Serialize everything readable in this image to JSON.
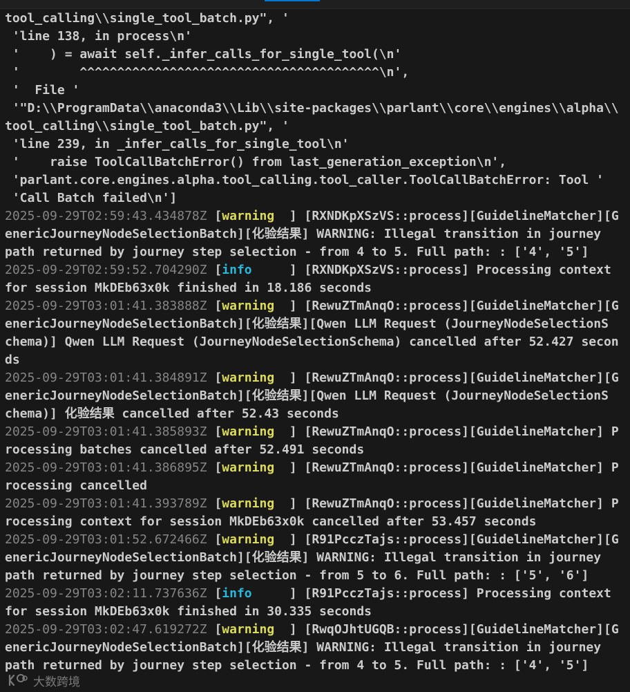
{
  "terminal": {
    "lines": [
      [
        {
          "t": "tool_calling\\\\single_tool_batch.py\", '"
        }
      ],
      [
        {
          "t": " 'line 138, in process\\n'"
        }
      ],
      [
        {
          "t": " '    ) = await self._infer_calls_for_single_tool(\\n'"
        }
      ],
      [
        {
          "t": " '        ^^^^^^^^^^^^^^^^^^^^^^^^^^^^^^^^^^^^^^^^\\n',"
        }
      ],
      [
        {
          "t": " '  File '"
        }
      ],
      [
        {
          "t": " '\"D:\\\\ProgramData\\\\anaconda3\\\\Lib\\\\site-packages\\\\parlant\\\\core\\\\engines\\\\alpha\\\\"
        }
      ],
      [
        {
          "t": "tool_calling\\\\single_tool_batch.py\", '"
        }
      ],
      [
        {
          "t": " 'line 239, in _infer_calls_for_single_tool\\n'"
        }
      ],
      [
        {
          "t": " '    raise ToolCallBatchError() from last_generation_exception\\n',"
        }
      ],
      [
        {
          "t": " 'parlant.core.engines.alpha.tool_calling.tool_caller.ToolCallBatchError: Tool '"
        }
      ],
      [
        {
          "t": " 'Call Batch failed\\n']"
        }
      ],
      [
        {
          "c": "ts",
          "t": "2025-09-29T02:59:43.434878Z"
        },
        {
          "t": " ["
        },
        {
          "c": "lvl-warning",
          "t": "warning"
        },
        {
          "t": "  ] [RXNDKpXSzVS::process][GuidelineMatcher][G"
        }
      ],
      [
        {
          "t": "enericJourneyNodeSelectionBatch]["
        },
        {
          "c": "cjk",
          "t": "化验结果"
        },
        {
          "t": "] WARNING: Illegal transition in journey"
        }
      ],
      [
        {
          "t": "path returned by journey step selection - from 4 to 5. Full path: : ['4', '5']"
        }
      ],
      [
        {
          "c": "ts",
          "t": "2025-09-29T02:59:52.704290Z"
        },
        {
          "t": " ["
        },
        {
          "c": "lvl-info",
          "t": "info"
        },
        {
          "t": "     ] [RXNDKpXSzVS::process] Processing context"
        }
      ],
      [
        {
          "t": "for session MkDEb63x0k finished in 18.186 seconds"
        }
      ],
      [
        {
          "c": "ts",
          "t": "2025-09-29T03:01:41.383888Z"
        },
        {
          "t": " ["
        },
        {
          "c": "lvl-warning",
          "t": "warning"
        },
        {
          "t": "  ] [RewuZTmAnqO::process][GuidelineMatcher][G"
        }
      ],
      [
        {
          "t": "enericJourneyNodeSelectionBatch]["
        },
        {
          "c": "cjk",
          "t": "化验结果"
        },
        {
          "t": "][Qwen LLM Request (JourneyNodeSelectionS"
        }
      ],
      [
        {
          "t": "chema)] Qwen LLM Request (JourneyNodeSelectionSchema) cancelled after 52.427 secon"
        }
      ],
      [
        {
          "t": "ds"
        }
      ],
      [
        {
          "c": "ts",
          "t": "2025-09-29T03:01:41.384891Z"
        },
        {
          "t": " ["
        },
        {
          "c": "lvl-warning",
          "t": "warning"
        },
        {
          "t": "  ] [RewuZTmAnqO::process][GuidelineMatcher][G"
        }
      ],
      [
        {
          "t": "enericJourneyNodeSelectionBatch]["
        },
        {
          "c": "cjk",
          "t": "化验结果"
        },
        {
          "t": "][Qwen LLM Request (JourneyNodeSelectionS"
        }
      ],
      [
        {
          "t": "chema)] "
        },
        {
          "c": "cjk",
          "t": "化验结果"
        },
        {
          "t": " cancelled after 52.43 seconds"
        }
      ],
      [
        {
          "c": "ts",
          "t": "2025-09-29T03:01:41.385893Z"
        },
        {
          "t": " ["
        },
        {
          "c": "lvl-warning",
          "t": "warning"
        },
        {
          "t": "  ] [RewuZTmAnqO::process][GuidelineMatcher] P"
        }
      ],
      [
        {
          "t": "rocessing batches cancelled after 52.491 seconds"
        }
      ],
      [
        {
          "c": "ts",
          "t": "2025-09-29T03:01:41.386895Z"
        },
        {
          "t": " ["
        },
        {
          "c": "lvl-warning",
          "t": "warning"
        },
        {
          "t": "  ] [RewuZTmAnqO::process][GuidelineMatcher] P"
        }
      ],
      [
        {
          "t": "rocessing cancelled"
        }
      ],
      [
        {
          "c": "ts",
          "t": "2025-09-29T03:01:41.393789Z"
        },
        {
          "t": " ["
        },
        {
          "c": "lvl-warning",
          "t": "warning"
        },
        {
          "t": "  ] [RewuZTmAnqO::process][GuidelineMatcher] P"
        }
      ],
      [
        {
          "t": "rocessing context for session MkDEb63x0k cancelled after 53.457 seconds"
        }
      ],
      [
        {
          "c": "ts",
          "t": "2025-09-29T03:01:52.672466Z"
        },
        {
          "t": " ["
        },
        {
          "c": "lvl-warning",
          "t": "warning"
        },
        {
          "t": "  ] [R91PcczTajs::process][GuidelineMatcher][G"
        }
      ],
      [
        {
          "t": "enericJourneyNodeSelectionBatch]["
        },
        {
          "c": "cjk",
          "t": "化验结果"
        },
        {
          "t": "] WARNING: Illegal transition in journey"
        }
      ],
      [
        {
          "t": "path returned by journey step selection - from 5 to 6. Full path: : ['5', '6']"
        }
      ],
      [
        {
          "c": "ts",
          "t": "2025-09-29T03:02:11.737636Z"
        },
        {
          "t": " ["
        },
        {
          "c": "lvl-info",
          "t": "info"
        },
        {
          "t": "     ] [R91PcczTajs::process] Processing context"
        }
      ],
      [
        {
          "t": "for session MkDEb63x0k finished in 30.335 seconds"
        }
      ],
      [
        {
          "c": "ts",
          "t": "2025-09-29T03:02:47.619272Z"
        },
        {
          "t": " ["
        },
        {
          "c": "lvl-warning",
          "t": "warning"
        },
        {
          "t": "  ] [RwqOJhtUGQB::process][GuidelineMatcher][G"
        }
      ],
      [
        {
          "t": "enericJourneyNodeSelectionBatch]["
        },
        {
          "c": "cjk",
          "t": "化验结果"
        },
        {
          "t": "] WARNING: Illegal transition in journey"
        }
      ],
      [
        {
          "t": "path returned by journey step selection - from 4 to 5. Full path: : ['4', '5']"
        }
      ]
    ]
  },
  "watermark": {
    "text": "大数跨境",
    "icon": "brand-logo-icon"
  },
  "colors": {
    "background": "#181818",
    "text": "#cccccc",
    "timestamp": "#858585",
    "warning": "#dcdc5a",
    "info": "#29b8db",
    "accent": "#0078d4"
  }
}
